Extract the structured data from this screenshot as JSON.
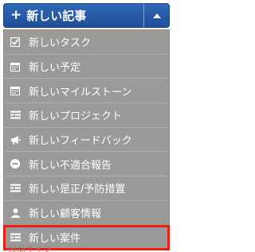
{
  "button": {
    "label": "新しい記事",
    "icon": "plus-icon",
    "caret_icon": "caret-up-icon",
    "color": "#2458a6"
  },
  "menu": {
    "background": "#9a9a98",
    "highlight_color": "#ee1d0f",
    "items": [
      {
        "label": "新しいタスク",
        "icon": "checkbox-icon"
      },
      {
        "label": "新しい予定",
        "icon": "calendar-icon"
      },
      {
        "label": "新しいマイルストーン",
        "icon": "calendar-icon"
      },
      {
        "label": "新しいプロジェクト",
        "icon": "list-icon"
      },
      {
        "label": "新しいフィードバック",
        "icon": "megaphone-icon"
      },
      {
        "label": "新しい不適合報告",
        "icon": "minus-circle-icon"
      },
      {
        "label": "新しい是正/予防措置",
        "icon": "list-icon"
      },
      {
        "label": "新しい顧客情報",
        "icon": "user-icon"
      },
      {
        "label": "新しい案件",
        "icon": "list-icon",
        "highlighted": true
      }
    ]
  },
  "below_text": "製品サイフ"
}
